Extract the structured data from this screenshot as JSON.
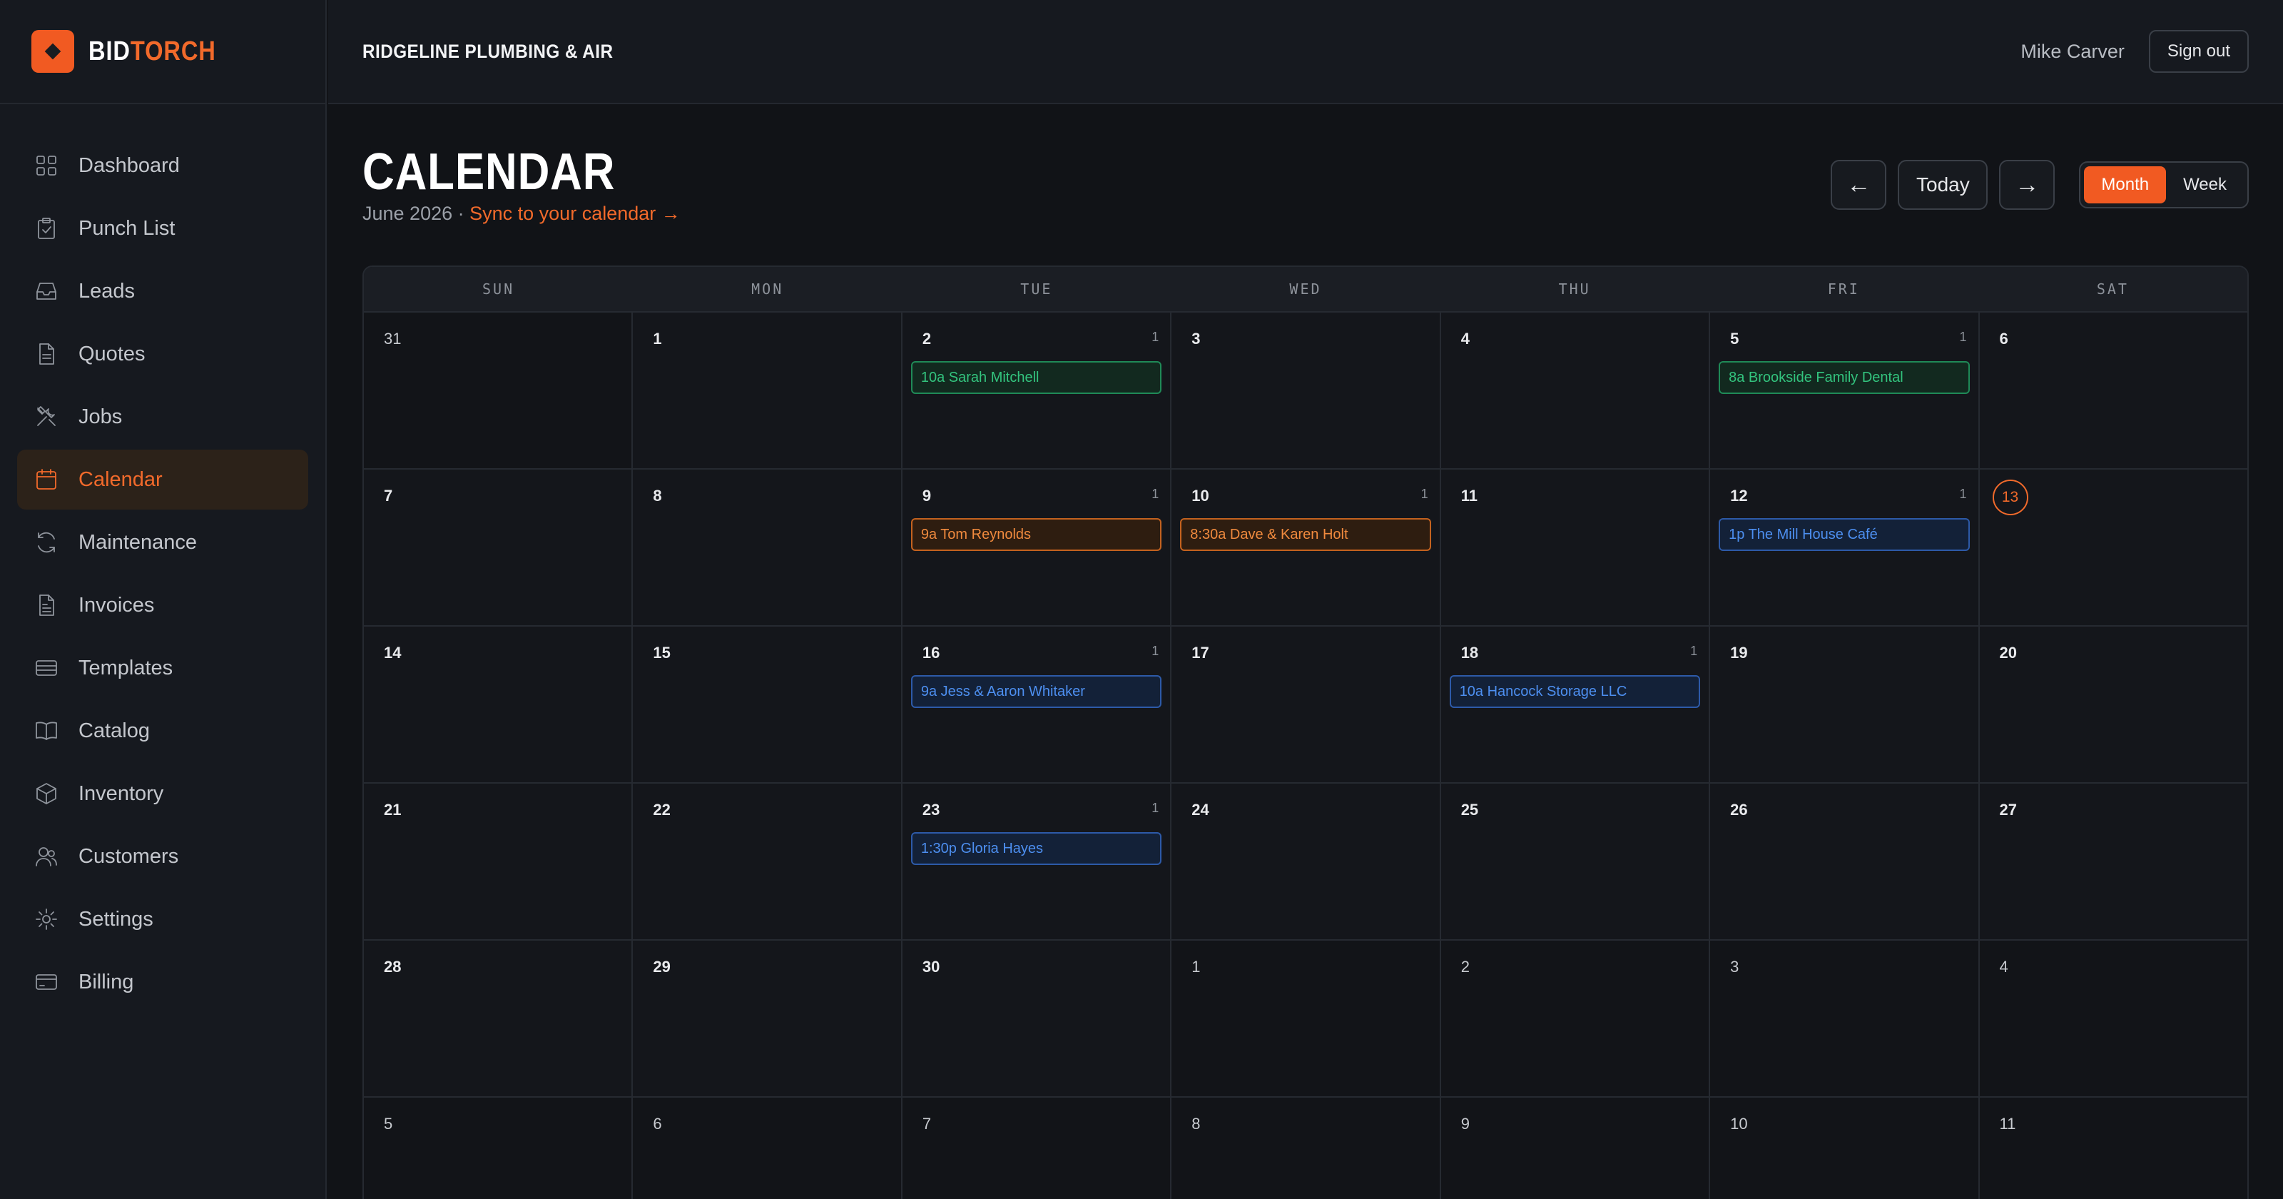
{
  "brand": {
    "name_a": "BID",
    "name_b": "TORCH",
    "accent": "#f15a22"
  },
  "header": {
    "company": "RIDGELINE PLUMBING & AIR",
    "user": "Mike Carver",
    "signout": "Sign out"
  },
  "sidebar": {
    "items": [
      {
        "label": "Dashboard",
        "icon": "grid-icon"
      },
      {
        "label": "Punch List",
        "icon": "clipboard-check-icon"
      },
      {
        "label": "Leads",
        "icon": "inbox-icon"
      },
      {
        "label": "Quotes",
        "icon": "document-icon"
      },
      {
        "label": "Jobs",
        "icon": "tools-icon"
      },
      {
        "label": "Calendar",
        "icon": "calendar-icon",
        "active": true
      },
      {
        "label": "Maintenance",
        "icon": "refresh-icon"
      },
      {
        "label": "Invoices",
        "icon": "invoice-icon"
      },
      {
        "label": "Templates",
        "icon": "template-icon"
      },
      {
        "label": "Catalog",
        "icon": "book-icon"
      },
      {
        "label": "Inventory",
        "icon": "box-icon"
      },
      {
        "label": "Customers",
        "icon": "users-icon"
      },
      {
        "label": "Settings",
        "icon": "gear-icon"
      },
      {
        "label": "Billing",
        "icon": "credit-card-icon"
      }
    ]
  },
  "page": {
    "title": "CALENDAR",
    "month": "June 2026",
    "separator": " · ",
    "sync": "Sync to your calendar →"
  },
  "controls": {
    "prev": "←",
    "today": "Today",
    "next": "→",
    "month": "Month",
    "week": "Week"
  },
  "calendar": {
    "days_of_week": [
      "SUN",
      "MON",
      "TUE",
      "WED",
      "THU",
      "FRI",
      "SAT"
    ],
    "weeks": [
      [
        {
          "day": "31",
          "current": false
        },
        {
          "day": "1",
          "current": true
        },
        {
          "day": "2",
          "current": true,
          "count": "1",
          "event": {
            "text": "10a Sarah Mitchell",
            "color": "green"
          }
        },
        {
          "day": "3",
          "current": true
        },
        {
          "day": "4",
          "current": true
        },
        {
          "day": "5",
          "current": true,
          "count": "1",
          "event": {
            "text": "8a Brookside Family Dental",
            "color": "green"
          }
        },
        {
          "day": "6",
          "current": true
        }
      ],
      [
        {
          "day": "7",
          "current": true
        },
        {
          "day": "8",
          "current": true
        },
        {
          "day": "9",
          "current": true,
          "count": "1",
          "event": {
            "text": "9a Tom Reynolds",
            "color": "orange"
          }
        },
        {
          "day": "10",
          "current": true,
          "count": "1",
          "event": {
            "text": "8:30a Dave & Karen Holt",
            "color": "orange"
          }
        },
        {
          "day": "11",
          "current": true
        },
        {
          "day": "12",
          "current": true,
          "count": "1",
          "event": {
            "text": "1p The Mill House Café",
            "color": "blue"
          }
        },
        {
          "day": "13",
          "current": true,
          "today": true
        }
      ],
      [
        {
          "day": "14",
          "current": true
        },
        {
          "day": "15",
          "current": true
        },
        {
          "day": "16",
          "current": true,
          "count": "1",
          "event": {
            "text": "9a Jess & Aaron Whitaker",
            "color": "blue"
          }
        },
        {
          "day": "17",
          "current": true
        },
        {
          "day": "18",
          "current": true,
          "count": "1",
          "event": {
            "text": "10a Hancock Storage LLC",
            "color": "blue"
          }
        },
        {
          "day": "19",
          "current": true
        },
        {
          "day": "20",
          "current": true
        }
      ],
      [
        {
          "day": "21",
          "current": true
        },
        {
          "day": "22",
          "current": true
        },
        {
          "day": "23",
          "current": true,
          "count": "1",
          "event": {
            "text": "1:30p Gloria Hayes",
            "color": "blue"
          }
        },
        {
          "day": "24",
          "current": true
        },
        {
          "day": "25",
          "current": true
        },
        {
          "day": "26",
          "current": true
        },
        {
          "day": "27",
          "current": true
        }
      ],
      [
        {
          "day": "28",
          "current": true
        },
        {
          "day": "29",
          "current": true
        },
        {
          "day": "30",
          "current": true
        },
        {
          "day": "1",
          "current": false
        },
        {
          "day": "2",
          "current": false
        },
        {
          "day": "3",
          "current": false
        },
        {
          "day": "4",
          "current": false
        }
      ],
      [
        {
          "day": "5",
          "current": false
        },
        {
          "day": "6",
          "current": false
        },
        {
          "day": "7",
          "current": false
        },
        {
          "day": "8",
          "current": false
        },
        {
          "day": "9",
          "current": false
        },
        {
          "day": "10",
          "current": false
        },
        {
          "day": "11",
          "current": false
        }
      ]
    ]
  }
}
